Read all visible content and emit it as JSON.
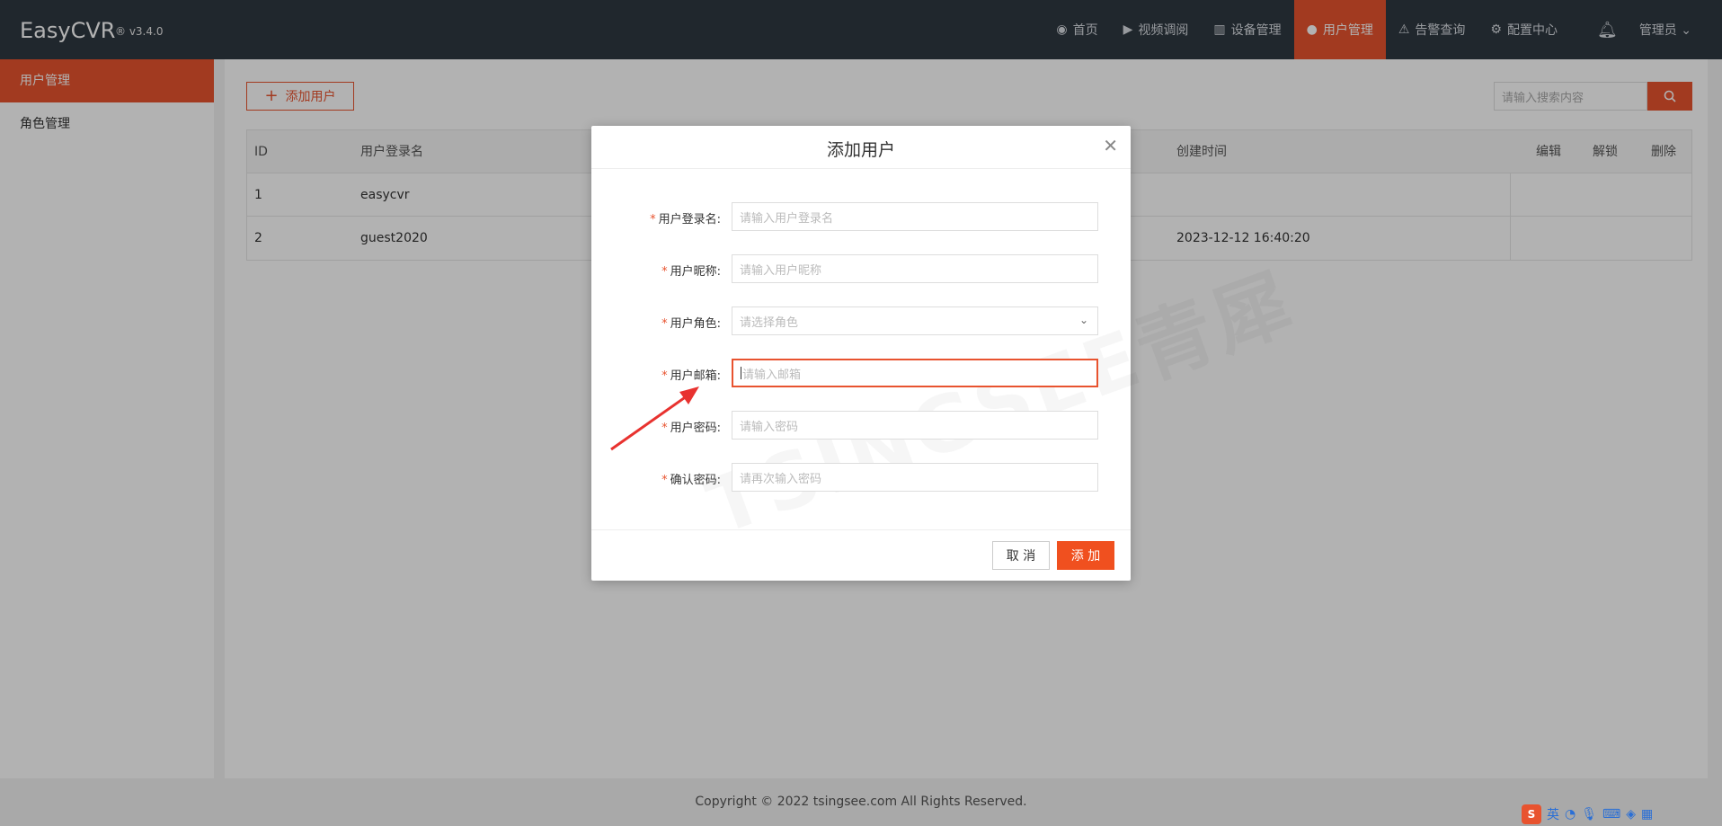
{
  "app": {
    "name": "EasyCVR",
    "version": "® v3.4.0"
  },
  "nav": [
    {
      "label": "首页",
      "icon": "dashboard-icon",
      "glyph": "◉",
      "active": false
    },
    {
      "label": "视频调阅",
      "icon": "play-circle-icon",
      "glyph": "▶",
      "active": false
    },
    {
      "label": "设备管理",
      "icon": "device-icon",
      "glyph": "▥",
      "active": false
    },
    {
      "label": "用户管理",
      "icon": "user-icon",
      "glyph": "●",
      "active": true
    },
    {
      "label": "告警查询",
      "icon": "alarm-icon",
      "glyph": "⚠",
      "active": false
    },
    {
      "label": "配置中心",
      "icon": "gear-icon",
      "glyph": "⚙",
      "active": false
    }
  ],
  "header": {
    "user": "管理员 ⌄"
  },
  "sidebar": {
    "items": [
      {
        "label": "用户管理",
        "active": true
      },
      {
        "label": "角色管理",
        "active": false
      }
    ]
  },
  "toolbar": {
    "add_label": "添加用户",
    "search_placeholder": "请输入搜索内容"
  },
  "table": {
    "columns": {
      "id": "ID",
      "login": "用户登录名",
      "created": "创建时间",
      "edit": "编辑",
      "unlock": "解锁",
      "delete": "删除"
    },
    "rows": [
      {
        "id": "1",
        "login": "easycvr",
        "created": ""
      },
      {
        "id": "2",
        "login": "guest2020",
        "created": "2023-12-12 16:40:20"
      }
    ]
  },
  "modal": {
    "title": "添加用户",
    "fields": [
      {
        "label": "用户登录名:",
        "placeholder": "请输入用户登录名"
      },
      {
        "label": "用户昵称:",
        "placeholder": "请输入用户昵称"
      },
      {
        "label": "用户角色:",
        "placeholder": "请选择角色"
      },
      {
        "label": "用户邮箱:",
        "placeholder": "请输入邮箱"
      },
      {
        "label": "用户密码:",
        "placeholder": "请输入密码"
      },
      {
        "label": "确认密码:",
        "placeholder": "请再次输入密码"
      }
    ],
    "required_mark": "*",
    "cancel_label": "取 消",
    "submit_label": "添 加",
    "watermark": "TSINGSEE青犀"
  },
  "footer": {
    "copyright": "Copyright © 2022 tsingsee.com All Rights Reserved."
  },
  "taskbar": {
    "ime_lang": "英"
  },
  "colors": {
    "accent": "#e8532f",
    "topbar": "#2f3841",
    "arrow": "#e8322f"
  }
}
